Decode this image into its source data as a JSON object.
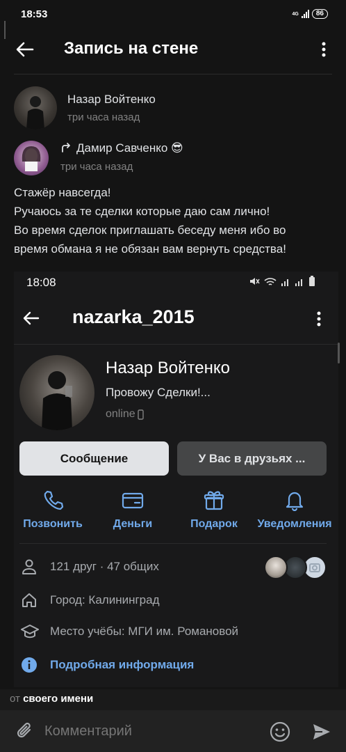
{
  "status_bar": {
    "time": "18:53",
    "network": "4G",
    "battery": "86"
  },
  "header": {
    "title": "Запись на стене"
  },
  "post": {
    "author": {
      "name": "Назар Войтенко",
      "time": "три часа назад"
    },
    "repost": {
      "name": "Дамир Савченко",
      "emoji": "😎",
      "time": "три часа назад"
    },
    "text_lines": [
      "Стажёр навсегда!",
      "Ручаюсь за те сделки которые даю сам лично!",
      "Во время сделок приглашать  беседу меня ибо во",
      "время обмана я не обязан вам вернуть средства!"
    ]
  },
  "screenshot": {
    "status_time": "18:08",
    "username": "nazarka_2015",
    "profile": {
      "name": "Назар Войтенко",
      "status": "Провожу Сделки!...",
      "online": "online"
    },
    "buttons": {
      "message": "Сообщение",
      "friends": "У Вас в друзьях ..."
    },
    "actions": [
      {
        "label": "Позвонить",
        "icon": "phone-icon"
      },
      {
        "label": "Деньги",
        "icon": "wallet-icon"
      },
      {
        "label": "Подарок",
        "icon": "gift-icon"
      },
      {
        "label": "Уведомления",
        "icon": "bell-icon"
      }
    ],
    "info": {
      "friends": "121 друг · 47 общих",
      "city": "Город: Калининград",
      "study": "Место учёбы: МГИ им. Романовой",
      "more": "Подробная информация"
    }
  },
  "comment_bar": {
    "as_prefix": "от",
    "as_name": "своего имени",
    "placeholder": "Комментарий"
  },
  "colors": {
    "accent": "#71aaeb",
    "background": "#141414",
    "secondary": "#828282"
  }
}
